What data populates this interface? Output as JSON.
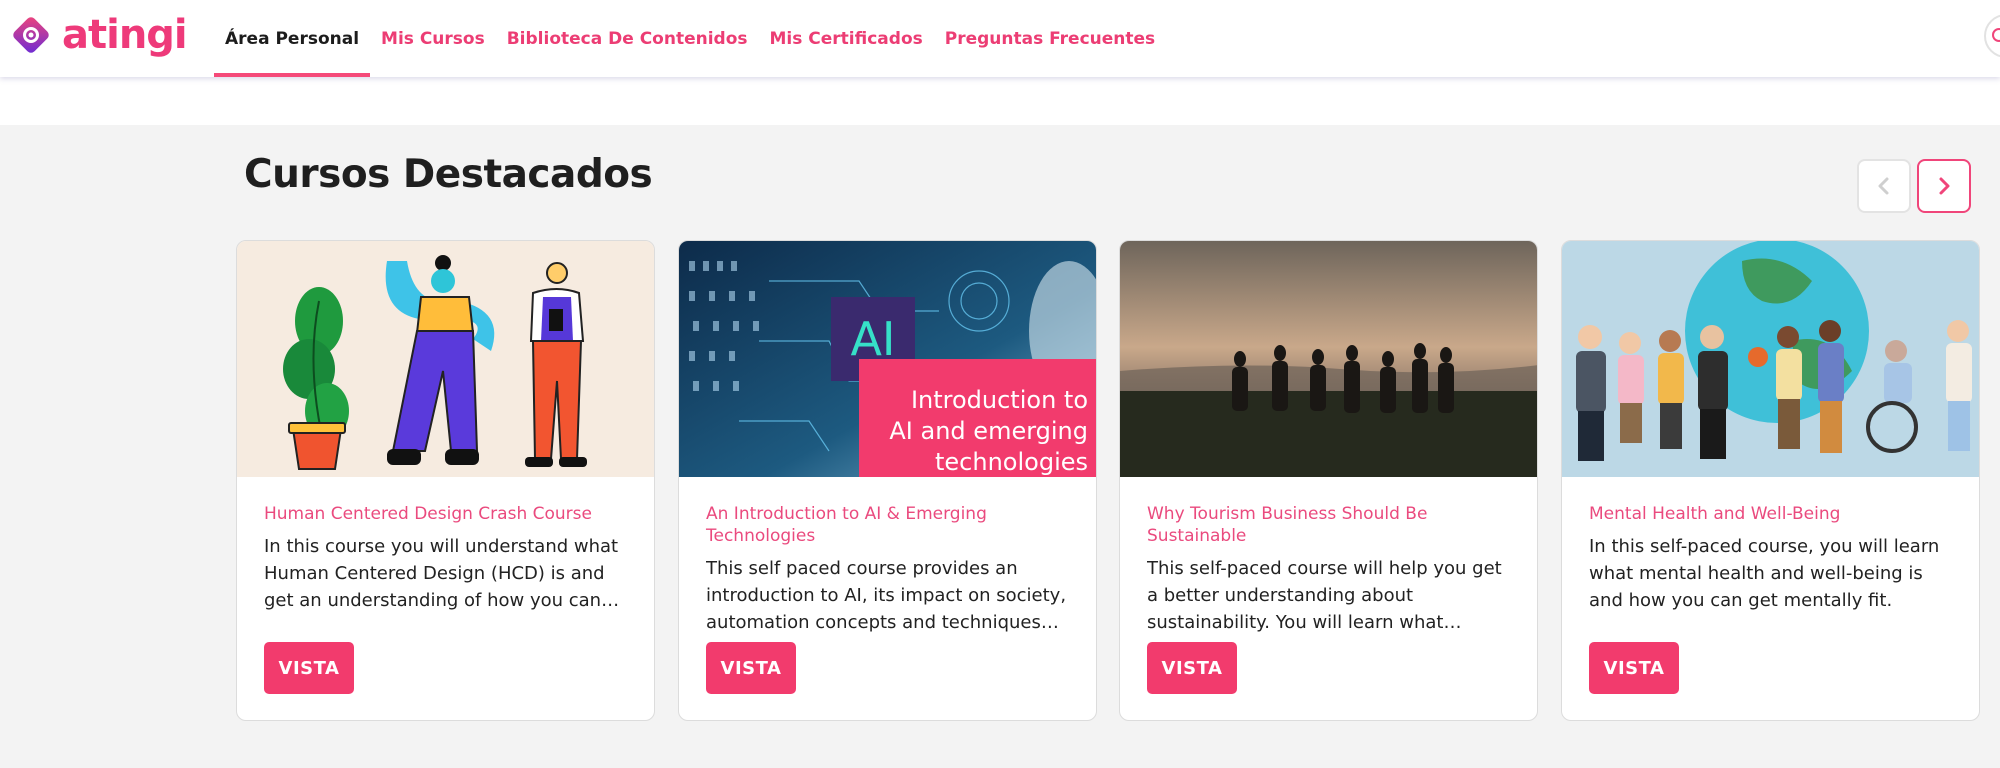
{
  "brand": {
    "name": "atingi",
    "color": "#ee3a7a"
  },
  "nav": [
    {
      "label": "Área Personal",
      "active": true
    },
    {
      "label": "Mis Cursos",
      "active": false
    },
    {
      "label": "Biblioteca De Contenidos",
      "active": false
    },
    {
      "label": "Mis Certificados",
      "active": false
    },
    {
      "label": "Preguntas Frecuentes",
      "active": false
    }
  ],
  "section": {
    "title": "Cursos Destacados",
    "prev_icon": "chevron-left-icon",
    "next_icon": "chevron-right-icon"
  },
  "cards": [
    {
      "title": "Human Centered Design Crash Course",
      "description": "In this course you will understand what Human Centered Design (HCD) is and get an understanding of how you can apply th…",
      "button": "VISTA"
    },
    {
      "title": "An Introduction to AI & Emerging Technologies",
      "description": "This self paced course provides an introduction to AI, its impact on society, automation concepts and techniques and…",
      "button": "VISTA",
      "image_text": {
        "logo": "AI",
        "line1": "Introduction to",
        "line2": "AI and emerging",
        "line3": "technologies"
      }
    },
    {
      "title": "Why Tourism Business Should Be Sustainable",
      "description": "This self-paced course will help you get a better understanding about sustainability. You will learn what sustainability compris…",
      "button": "VISTA"
    },
    {
      "title": "Mental Health and Well-Being",
      "description": "In this self-paced course, you will learn what mental health and well-being is and how you can get mentally fit.",
      "button": "VISTA"
    }
  ],
  "colors": {
    "accent": "#f23b6d",
    "link": "#ea4a7e",
    "page_bg": "#f3f3f3"
  }
}
